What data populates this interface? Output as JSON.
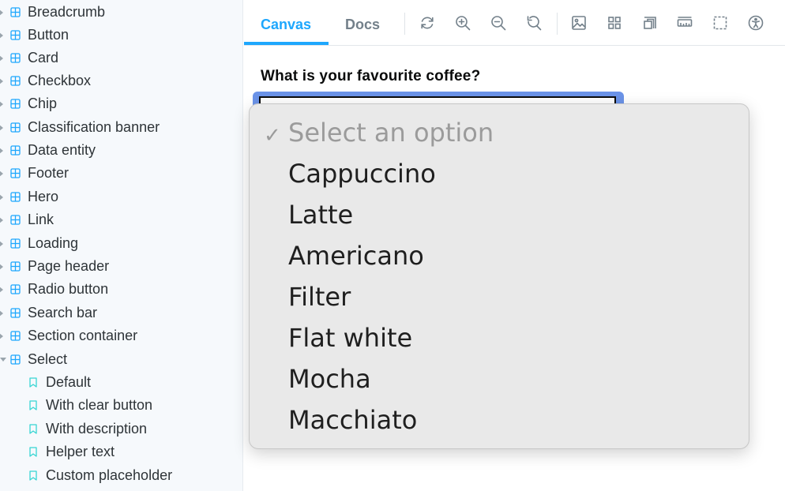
{
  "sidebar": {
    "components": [
      {
        "label": "Breadcrumb"
      },
      {
        "label": "Button"
      },
      {
        "label": "Card"
      },
      {
        "label": "Checkbox"
      },
      {
        "label": "Chip"
      },
      {
        "label": "Classification banner"
      },
      {
        "label": "Data entity"
      },
      {
        "label": "Footer"
      },
      {
        "label": "Hero"
      },
      {
        "label": "Link"
      },
      {
        "label": "Loading"
      },
      {
        "label": "Page header"
      },
      {
        "label": "Radio button"
      },
      {
        "label": "Search bar"
      },
      {
        "label": "Section container"
      },
      {
        "label": "Select",
        "expanded": true
      }
    ],
    "stories": [
      {
        "label": "Default"
      },
      {
        "label": "With clear button"
      },
      {
        "label": "With description"
      },
      {
        "label": "Helper text"
      },
      {
        "label": "Custom placeholder"
      }
    ]
  },
  "toolbar": {
    "tabs": [
      {
        "label": "Canvas",
        "active": true
      },
      {
        "label": "Docs",
        "active": false
      }
    ],
    "tools": [
      "reload-icon",
      "zoom-in-icon",
      "zoom-out-icon",
      "reset-zoom-icon",
      "background-icon",
      "grid-icon",
      "viewport-icon",
      "measure-icon",
      "outline-icon",
      "accessibility-icon"
    ]
  },
  "canvas": {
    "question": "What is your favourite coffee?"
  },
  "dropdown": {
    "selected_mark": "✓",
    "options": [
      {
        "label": "Select an option",
        "placeholder": true,
        "selected": true
      },
      {
        "label": "Cappuccino"
      },
      {
        "label": "Latte"
      },
      {
        "label": "Americano"
      },
      {
        "label": "Filter"
      },
      {
        "label": "Flat white"
      },
      {
        "label": "Mocha"
      },
      {
        "label": "Macchiato"
      }
    ]
  },
  "colors": {
    "accent": "#1ea7fd",
    "focus_ring": "#6b93e8",
    "sidebar_bg": "#f6f9fc"
  }
}
